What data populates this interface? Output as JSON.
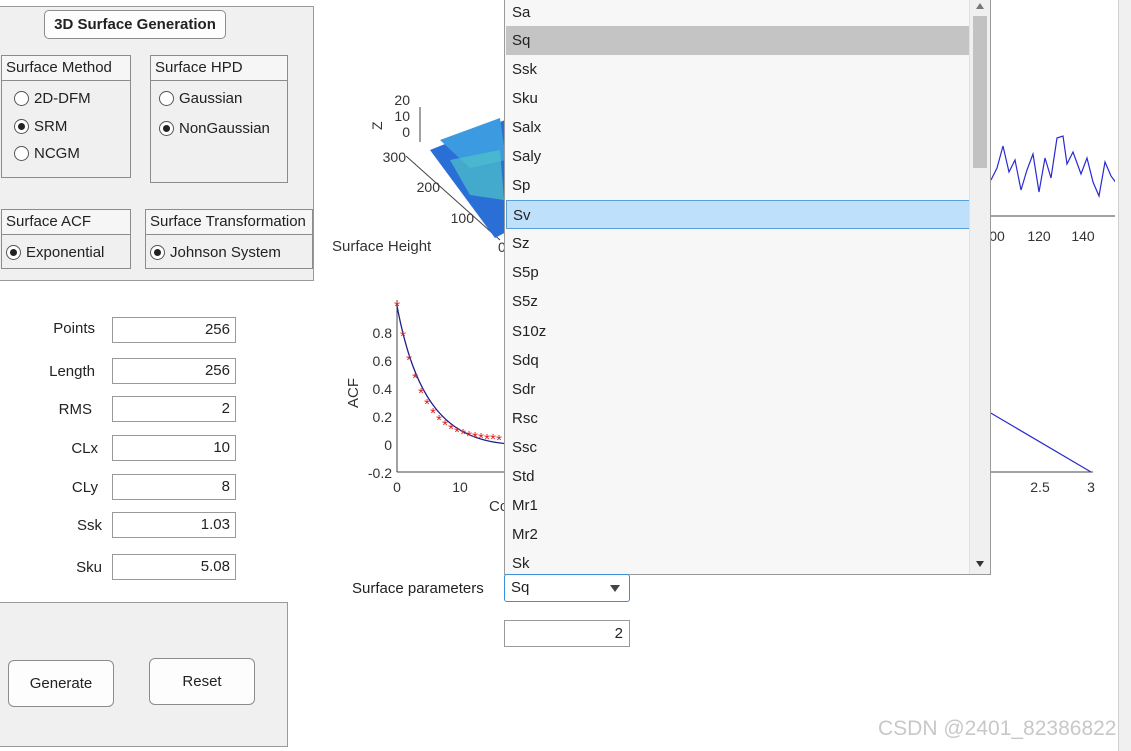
{
  "panel": {
    "title": "3D Surface Generation",
    "surface_method": {
      "title": "Surface Method",
      "options": [
        {
          "label": "2D-DFM",
          "checked": false
        },
        {
          "label": "SRM",
          "checked": true
        },
        {
          "label": "NCGM",
          "checked": false
        }
      ]
    },
    "surface_hpd": {
      "title": "Surface HPD",
      "options": [
        {
          "label": "Gaussian",
          "checked": false
        },
        {
          "label": "NonGaussian",
          "checked": true
        }
      ]
    },
    "surface_acf": {
      "title": "Surface ACF",
      "options": [
        {
          "label": "Exponential",
          "checked": true
        }
      ]
    },
    "surface_transformation": {
      "title": "Surface Transformation",
      "options": [
        {
          "label": "Johnson System",
          "checked": true
        }
      ]
    },
    "fields": [
      {
        "label": "Points",
        "value": "256"
      },
      {
        "label": "Length",
        "value": "256"
      },
      {
        "label": "RMS",
        "value": "2"
      },
      {
        "label": "CLx",
        "value": "10"
      },
      {
        "label": "CLy",
        "value": "8"
      },
      {
        "label": "Ssk",
        "value": "1.03"
      },
      {
        "label": "Sku",
        "value": "5.08"
      }
    ],
    "buttons": {
      "generate": "Generate",
      "reset": "Reset"
    }
  },
  "plots": {
    "surface_3d": {
      "title": "Surface Height",
      "zlabel": "Z",
      "z_ticks": [
        "20",
        "10",
        "0"
      ],
      "y_ticks": [
        "300",
        "200",
        "100"
      ],
      "x_tick_partial": "0"
    },
    "profile": {
      "x_ticks": [
        "00",
        "120",
        "140"
      ]
    },
    "acf": {
      "ylabel": "ACF",
      "y_ticks": [
        "0.8",
        "0.6",
        "0.4",
        "0.2",
        "0",
        "-0.2"
      ],
      "x_ticks": [
        "0",
        "10"
      ],
      "xlabel_partial": "Co",
      "right_x_ticks": [
        "2.5",
        "3"
      ]
    }
  },
  "parameter_select": {
    "label": "Surface parameters",
    "selected": "Sq",
    "value": "2",
    "options": [
      "Sa",
      "Sq",
      "Ssk",
      "Sku",
      "Salx",
      "Saly",
      "Sp",
      "Sv",
      "Sz",
      "S5p",
      "S5z",
      "S10z",
      "Sdq",
      "Sdr",
      "Rsc",
      "Ssc",
      "Std",
      "Mr1",
      "Mr2",
      "Sk"
    ],
    "hovered": "Sq",
    "highlighted": "Sv"
  },
  "watermark": "CSDN @2401_82386822",
  "colors": {
    "surface": "#2a6fd6",
    "acf_curve": "#1f1f8a",
    "acf_markers": "#e0201e",
    "profile_line": "#2a2ad0",
    "selected_item": "#bfe0fb"
  }
}
